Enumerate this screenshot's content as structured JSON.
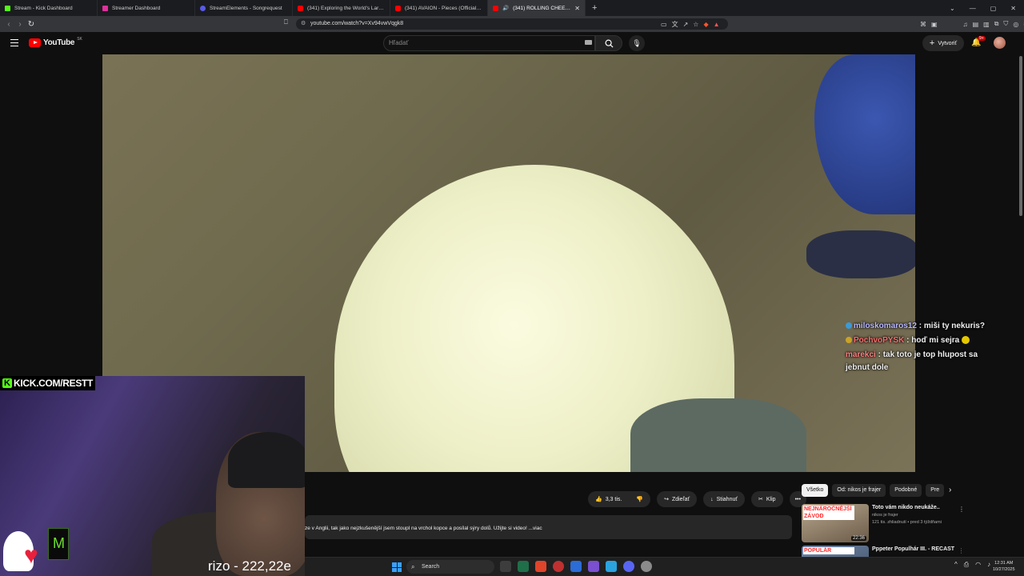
{
  "tabs": [
    {
      "title": "Stream - Kick Dashboard",
      "color": "#53fc18",
      "active": false
    },
    {
      "title": "Streamer Dashboard",
      "color": "#e0309a",
      "active": false
    },
    {
      "title": "StreamElements - Songrequest",
      "color": "#5a5ae6",
      "active": false
    },
    {
      "title": "(341) Exploring the World's Largest S",
      "color": "#ff0000",
      "active": false
    },
    {
      "title": "(341) AVAION - Pieces (Official Video",
      "color": "#ff0000",
      "active": false
    },
    {
      "title": "(341) ROLLING CHEESE - pos",
      "color": "#ff0000",
      "active": true
    }
  ],
  "address": {
    "url": "youtube.com/watch?v=Xv94vwVqgk8"
  },
  "youtube": {
    "logo_text": "YouTube",
    "region": "SK",
    "search_placeholder": "Hľadať",
    "create_label": "Vytvoriť",
    "notifications_badge": "9+"
  },
  "chat": [
    {
      "user": "miloskomaros12",
      "text": ": miši ty nekuris?"
    },
    {
      "user": "PochvoPYSK",
      "text": ": hoď mi sejra"
    },
    {
      "user": "marekci",
      "text": ": tak toto je top hlupost sa jebnut dole"
    }
  ],
  "overlay": {
    "kick_k": "K",
    "kick_url": "KICK.COM/RESTT",
    "counter": "rizo - 222,22e",
    "monster": "M"
  },
  "actions": {
    "likes": "3,3 tis.",
    "share": "Zdieľať",
    "download": "Stiahnuť",
    "clip": "Klip",
    "more": "•••"
  },
  "description": "ze v Anglii, tak jako nejzkušenější jsem stoupl na vrchol kopce a posílal sýry dolů. Užijte si video! ...viac",
  "chips": [
    "Všetko",
    "Od: nikos je frajer",
    "Podobné",
    "Pre"
  ],
  "recommendations": [
    {
      "thumb_label": "NEJNÁROČNĚJŠÍ ZÁVOD",
      "title": "Toto vám nikdo neukáže..",
      "channel": "nikos je frajer",
      "meta": "121 tis. zhliadnutí • pred 3 týždňami",
      "duration": "22:36",
      "thumb_color": "#8a7a68"
    },
    {
      "thumb_label": "POPULÁR",
      "title": "Pppeter Populhár III. - RECAST",
      "channel": "",
      "meta": "",
      "duration": "",
      "thumb_color": "#5a6f8a"
    }
  ],
  "taskbar": {
    "search": "Search",
    "time": "12:31 AM",
    "date": "10/27/2025",
    "apps": [
      "#3d3d3d",
      "#1f6f4a",
      "#e0442a",
      "#c03030",
      "#2b6cd6",
      "#7a4fd0",
      "#2aa3e0",
      "#5865f2",
      "#8a8a8a"
    ]
  },
  "colors": {
    "accent": "#ff0000",
    "kick": "#53fc18"
  }
}
